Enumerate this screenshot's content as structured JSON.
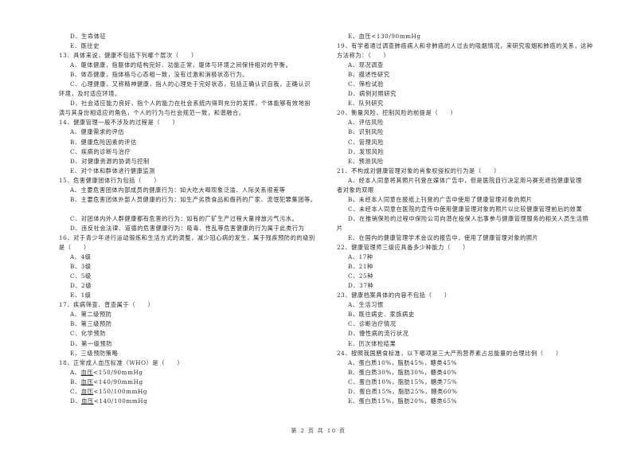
{
  "left_column": [
    {
      "type": "opt",
      "text": "D、生命体征"
    },
    {
      "type": "opt",
      "text": "E、既往史"
    },
    {
      "type": "q",
      "text": "13、具体来说，健康不包括下列哪个层次（　　）"
    },
    {
      "type": "opt",
      "text": "A、躯体健康，指躯体的结构完好、功能正常，躯体与环境之间保持相对的平衡。"
    },
    {
      "type": "opt",
      "text": "B、体态健康，指体格与心态相一致，没有过激和消极状态行为。"
    },
    {
      "type": "opt",
      "text": "C、心理健康，又称精神健康，指人的心理处于完好状态，包括正确认识自我，正确认识"
    },
    {
      "type": "cont",
      "text": "环境，及时适应环境。"
    },
    {
      "type": "opt",
      "text": "D、社会适应能力良好，指个人的能力在社会系统内得到充分的发挥，个体能够有效地扮"
    },
    {
      "type": "cont",
      "text": "演与其身份相适应的角色，个人的行为与社会规范一致，和谐融合。"
    },
    {
      "type": "q",
      "text": "14、健康管理一般不涉及的过程是（　　）"
    },
    {
      "type": "opt",
      "text": "A、健康需求的评估"
    },
    {
      "type": "opt",
      "text": "B、健康危险因素的评估"
    },
    {
      "type": "opt",
      "text": "C、疾病的诊断与治疗"
    },
    {
      "type": "opt",
      "text": "D、对健康资源的协调与控制"
    },
    {
      "type": "opt",
      "text": "E、对个体和群体进行健康监测"
    },
    {
      "type": "q",
      "text": "15、危害健康团体行为包括（　　）"
    },
    {
      "type": "opt",
      "text": "A、主要危害团体内部成员的健康行为：如大吃大喝现象泛滥、人际关系很差等"
    },
    {
      "type": "opt",
      "text": "B、主要危害团体外部人员健康的行为：如生产劣质食品和假药的厂家、流氓犯罪集团等。"
    },
    {
      "type": "blank",
      "text": ""
    },
    {
      "type": "opt",
      "text": "C、对团体内外人群健康都有危害的行为：如有的厂矿生产过程大量排放污气污水。"
    },
    {
      "type": "opt",
      "text": "D、违反社会法律、道德的危害健康行为：吸毒、性乱等危害健康的行为属于此类行为"
    },
    {
      "type": "q",
      "text": "16、对于青少年进行运动锻炼和生活方式的调整，减少冠心病的发生，属于残疾预防的的级别"
    },
    {
      "type": "cont",
      "text": "是（　　）"
    },
    {
      "type": "opt",
      "text": "A、4级"
    },
    {
      "type": "opt",
      "text": "B、3级"
    },
    {
      "type": "opt",
      "text": "C、5级"
    },
    {
      "type": "opt",
      "text": "D、2级"
    },
    {
      "type": "opt",
      "text": "E、1级"
    },
    {
      "type": "q",
      "text": "17、疾病筛查、普查属于（　　）"
    },
    {
      "type": "opt",
      "text": "A、第二级预防"
    },
    {
      "type": "opt",
      "text": "B、第三级预防"
    },
    {
      "type": "opt",
      "text": "C、化学预防"
    },
    {
      "type": "opt",
      "text": "D、第一级预防"
    },
    {
      "type": "opt",
      "text": "E、三级预防策略"
    },
    {
      "type": "q",
      "text": "18、正常成人血压标准（WHO）是（　　）"
    },
    {
      "type": "opt",
      "prefix": "A、",
      "underline": "血压",
      "text": "<150/90mmHg"
    },
    {
      "type": "opt",
      "prefix": "B、",
      "underline": "血压",
      "text": "<140/90mmHg"
    },
    {
      "type": "opt",
      "prefix": "C、",
      "underline": "血压",
      "text": "<150/100mmHg"
    },
    {
      "type": "opt",
      "prefix": "D、",
      "underline": "血压",
      "text": "<140/100mmHg"
    }
  ],
  "right_column": [
    {
      "type": "opt",
      "text": "E、血压<130/90mmHg"
    },
    {
      "type": "q",
      "text": "19、有学者通过调查肺癌病人和非肺癌的人过去的吸烟情况，来研究吸烟和肺癌的关系，这种"
    },
    {
      "type": "cont",
      "text": "方法称为：（　　）"
    },
    {
      "type": "opt",
      "text": "A、现况调查"
    },
    {
      "type": "opt",
      "text": "B、描述性研究"
    },
    {
      "type": "opt",
      "text": "C、筛检试验"
    },
    {
      "type": "opt",
      "text": "D、病例对照研究"
    },
    {
      "type": "opt",
      "text": "E、队列研究"
    },
    {
      "type": "q",
      "text": "20、衡量风险、控制风险的前提是（　　）"
    },
    {
      "type": "opt",
      "text": "A、评估风险"
    },
    {
      "type": "opt",
      "text": "B、识别风险"
    },
    {
      "type": "opt",
      "text": "C、管理风险"
    },
    {
      "type": "opt",
      "text": "D、发现风险"
    },
    {
      "type": "opt",
      "text": "E、预测风险"
    },
    {
      "type": "q",
      "text": "21、不构成对健康管理对象的肖象权侵权的行为是（　　）"
    },
    {
      "type": "opt",
      "text": "A、经本人同意将其照片刊登在媒体广告中，但是医院自行决定用马赛克遮挡健康管理"
    },
    {
      "type": "cont",
      "text": "者对象的双眼"
    },
    {
      "type": "opt",
      "text": "B、未经本人同意在报纸上刊登的广告中使用了健康管理对象的照片"
    },
    {
      "type": "opt",
      "text": "C、未经本人同意在医院的宣传中使用健康管理对象的照片以比较健康管理前后的效果"
    },
    {
      "type": "opt",
      "text": "D、在推销保险的过程中保险公司向潜在投保人出事参与健康管理服务的相关人员生活照"
    },
    {
      "type": "cont",
      "text": "片"
    },
    {
      "type": "opt",
      "text": "E、在国内的健康管理学术会议的报告中，使用了健康管理对象的照片"
    },
    {
      "type": "q",
      "text": "22、健康管理师三级应具备多少种能力（　　）"
    },
    {
      "type": "opt",
      "text": "A、17种"
    },
    {
      "type": "opt",
      "text": "B、21种"
    },
    {
      "type": "opt",
      "text": "C、25种"
    },
    {
      "type": "opt",
      "text": "D、37种"
    },
    {
      "type": "q",
      "text": "23、健康档案具体的内容不包括（　　）"
    },
    {
      "type": "opt",
      "text": "A、生活习惯"
    },
    {
      "type": "opt",
      "text": "B、既往病史、家族病史"
    },
    {
      "type": "opt",
      "text": "C、诊断治疗情况"
    },
    {
      "type": "opt",
      "text": "D、慢性病的流行状况"
    },
    {
      "type": "opt",
      "text": "E、历次体检结果"
    },
    {
      "type": "q",
      "text": "24、按照我国膳食标准，以下哪项是三大产热营养素占总能量的合理比例（　　）"
    },
    {
      "type": "opt",
      "text": "A、蛋白质10%，脂肪45%，糖类45%"
    },
    {
      "type": "opt",
      "text": "B、蛋白质30%，脂肪30%，糖类40%"
    },
    {
      "type": "opt",
      "text": "C、蛋白质10%，脂肪15%，糖类75%"
    },
    {
      "type": "opt",
      "text": "D、蛋白质15%，脂肪25%，糖类60%"
    },
    {
      "type": "opt",
      "text": "E、蛋白质15%，脂肪20%，糖类65%"
    }
  ],
  "footer": {
    "page_label": "第 2 页 共 10 页"
  }
}
